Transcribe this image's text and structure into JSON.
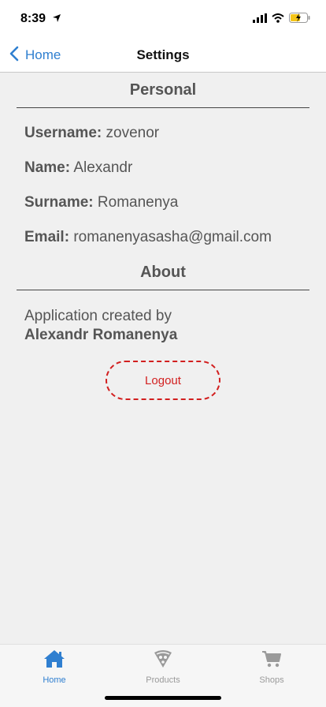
{
  "status_bar": {
    "time": "8:39",
    "icons": [
      "location-arrow-icon",
      "signal-icon",
      "wifi-icon",
      "battery-charging-icon"
    ]
  },
  "nav": {
    "back_label": "Home",
    "title": "Settings"
  },
  "personal": {
    "header": "Personal",
    "fields": [
      {
        "label": "Username:",
        "value": "zovenor"
      },
      {
        "label": "Name:",
        "value": "Alexandr"
      },
      {
        "label": "Surname:",
        "value": "Romanenya"
      },
      {
        "label": "Email:",
        "value": "romanenyasasha@gmail.com"
      }
    ]
  },
  "about": {
    "header": "About",
    "line1": "Application created by",
    "author": "Alexandr Romanenya"
  },
  "logout_label": "Logout",
  "tabs": [
    {
      "label": "Home",
      "icon": "house-icon",
      "active": true
    },
    {
      "label": "Products",
      "icon": "pizza-icon",
      "active": false
    },
    {
      "label": "Shops",
      "icon": "cart-icon",
      "active": false
    }
  ],
  "colors": {
    "accent": "#2f7fd0",
    "logout": "#d21f1f",
    "background": "#f0f0f0",
    "text": "#555555",
    "inactive_tab": "#9a9a9a"
  }
}
